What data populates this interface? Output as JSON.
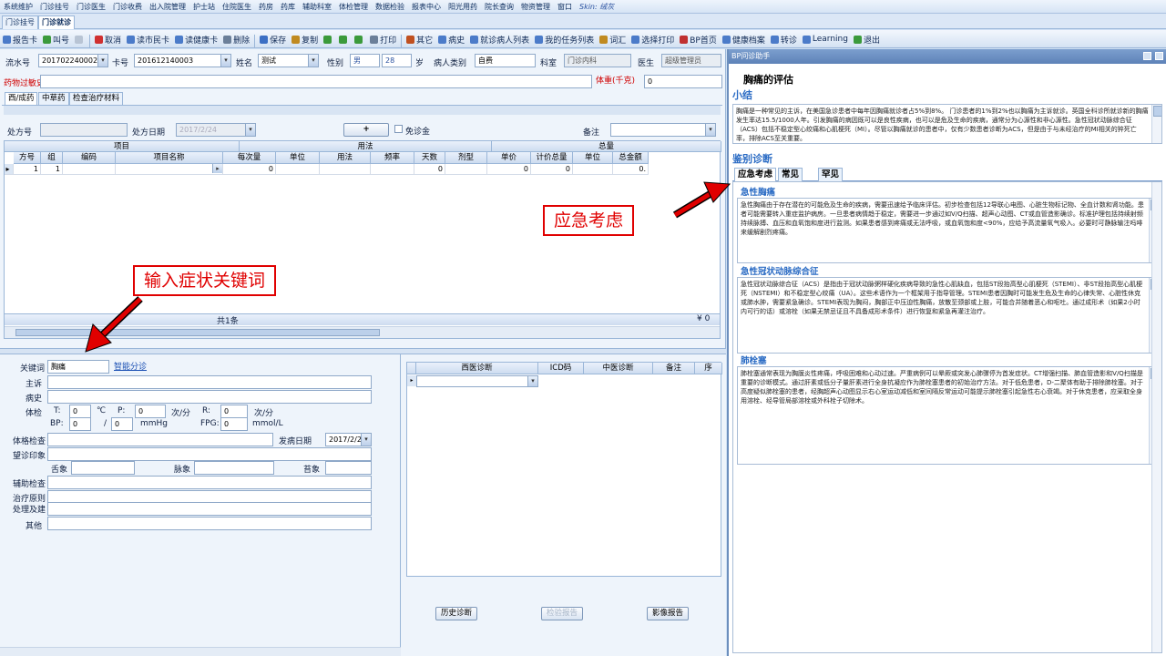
{
  "menu": [
    "系统维护",
    "门诊挂号",
    "门诊医生",
    "门诊收费",
    "出入院管理",
    "护士站",
    "住院医生",
    "药房",
    "药库",
    "辅助科室",
    "体检管理",
    "数据检验",
    "报表中心",
    "阳光用药",
    "院长查询",
    "物资管理",
    "窗口",
    "Skin: 绒灰"
  ],
  "top_tabs": [
    "门诊挂号",
    "门诊就诊"
  ],
  "toolbar": [
    "报告卡",
    "叫号",
    "",
    "取消",
    "读市民卡",
    "读健康卡",
    "删除",
    "保存",
    "复制",
    "",
    "",
    "",
    "打印",
    "其它",
    "病史",
    "就诊病人列表",
    "我的任务列表",
    "词汇",
    "选择打印",
    "BP首页",
    "健康档案",
    "转诊",
    "Learning",
    "退出"
  ],
  "patient": {
    "serial_label": "流水号",
    "serial": "201702240002",
    "card_label": "卡号",
    "card": "201612140003",
    "name_label": "姓名",
    "name": "测试",
    "gender_label": "性别",
    "gender": "男",
    "age": "28",
    "age_unit": "岁",
    "type_label": "病人类别",
    "type": "自费",
    "dept_label": "科室",
    "dept": "门诊内科",
    "doctor_label": "医生",
    "doctor": "超级管理员",
    "allergy_label": "药物过敏史:",
    "weight_label": "体重(千克)",
    "weight": "0"
  },
  "sub_tabs": [
    "西/成药",
    "中草药",
    "检查治疗材料"
  ],
  "rx": {
    "no_label": "处方号",
    "date_label": "处方日期",
    "date": "2017/2/24",
    "add": "+",
    "free_label": "免诊金",
    "note_label": "备注"
  },
  "grid": {
    "group_headers": [
      "项目",
      "用法",
      "总量"
    ],
    "columns": [
      "方号",
      "组",
      "编码",
      "项目名称",
      "每次量",
      "单位",
      "用法",
      "频率",
      "天数",
      "剂型",
      "单价",
      "计价总量",
      "单位",
      "总金额"
    ],
    "row": [
      "1",
      "1",
      "",
      "",
      "0",
      "",
      "",
      "",
      "0",
      "",
      "0",
      "0",
      "",
      "0."
    ],
    "count": "共1条",
    "total": "¥ 0"
  },
  "form": {
    "keyword_label": "关键词",
    "keyword": "胸痛",
    "smart_link": "智能分诊",
    "complaint_label": "主诉",
    "history_label": "病史",
    "vitals_label": "体检",
    "t": "T:",
    "t_val": "0",
    "t_unit": "℃",
    "p": "P:",
    "p_val": "0",
    "p_unit": "次/分",
    "r": "R:",
    "r_val": "0",
    "r_unit": "次/分",
    "bp": "BP:",
    "bp1": "0",
    "bp_sep": "/",
    "bp2": "0",
    "bp_unit": "mmHg",
    "fpg": "FPG:",
    "fpg_val": "0",
    "fpg_unit": "mmol/L",
    "exam_label": "体格检查",
    "onset_label": "发病日期",
    "onset": "2017/2/2",
    "impression_label": "望诊印象",
    "tongue_label": "舌象",
    "pulse_label": "脉象",
    "coat_label": "苔象",
    "aux_label": "辅助检查",
    "principle_label": "治疗原则",
    "advice_label": "处理及建",
    "other_label": "其他"
  },
  "diag": {
    "columns": [
      "西医诊断",
      "ICD码",
      "中医诊断",
      "备注",
      "序"
    ],
    "history_btn": "历史诊断",
    "lab_btn": "检验报告",
    "image_btn": "影像报告"
  },
  "right": {
    "header": "BP问诊助手",
    "title": "胸痛的评估",
    "summary_label": "小结",
    "summary": "胸痛是一种常见的主诉，在美国急诊患者中每年因胸痛就诊者占5%到8%。 门诊患者的1%到2%也以胸痛为主诉就诊。英国全科诊所就诊新的胸痛发生率达15.5/1000人年。引发胸痛的病因既可以是良性疾病，也可以是危及生命的疾病，通常分为心源性和非心源性。急性冠状动脉综合征（ACS）包括不稳定型心绞痛和心肌梗死（MI）。尽管以胸痛就诊的患者中，仅有少数患者诊断为ACS，但是由于与未经治疗的MI相关的猝死亡率，排除ACS至关重要。",
    "diff_label": "鉴别诊断",
    "diff_tabs": [
      "应急考虑",
      "常见",
      "罕见"
    ],
    "items": [
      {
        "title": "急性胸痛",
        "text": "急性胸痛由于存在潜在的可能危及生命的疾病，需要迅速给予临床评估。初步检查包括12导联心电图、心脏生物标记物、全血计数和肾功能。患者可能需要转入重症监护病房。一旦患者病情趋于稳定，需要进一步通过如V/Q扫描、超声心动图、CT或血管造影确诊。标准护理包括持续射频持续脉搏、血压和血氧饱和度进行监测。如果患者感到疼痛或无法呼吸，或血氧饱和度<90%，应给予高流量氧气吸入。必要时可静脉输注吗啡来缓解剧烈疼痛。"
      },
      {
        "title": "急性冠状动脉综合征",
        "text": "急性冠状动脉综合征（ACS）是指由于冠状动脉粥样硬化疾病导致的急性心肌缺血，包括ST段抬高型心肌梗死（STEMI）、非ST段抬高型心肌梗死（NSTEMI）和不稳定型心绞痛（UA）。这些术语作为一个框架用于指导管理。STEMI患者因胸时可能发生危及生命的心律失常、心脏性休克或肺水肿，需要紧急确诊。STEMI表现为胸闷，胸部正中压迫性胸痛，放散至颈部或上肢，可能合并随着恶心和呕吐。通过成形术（如果2小时内可行的话）或溶栓（如果无禁忌证且不具备成形术条件）进行恢复和紧急再灌注治疗。"
      },
      {
        "title": "肺栓塞",
        "text": "肺栓塞通常表现为胸膜炎性疼痛，呼吸困难和心动过速。严重病例可以晕厥或突发心肺骤停为首发症状。CT增强扫描、肺血管造影和V/Q扫描是重要的诊断模式。通过肝素或低分子量肝素进行全身抗凝应作为肺栓塞患者的初始治疗方法。对于低危患者，D-二聚体有助于排除肺栓塞。对于高度疑似肺栓塞的患者，经胸超声心动图显示右心室运动减低和室间隔反常运动可能提示肺栓塞引起急性右心衰竭。对于休克患者，应采取全身用溶栓、经导管局部溶栓或外科栓子切除术。"
      }
    ]
  },
  "annotations": {
    "keyword_hint": "输入症状关键词",
    "emergency_hint": "应急考虑"
  },
  "colors": {
    "accent": "#2a6bc4",
    "annotation": "#e00000",
    "panel": "#eef4fb"
  }
}
